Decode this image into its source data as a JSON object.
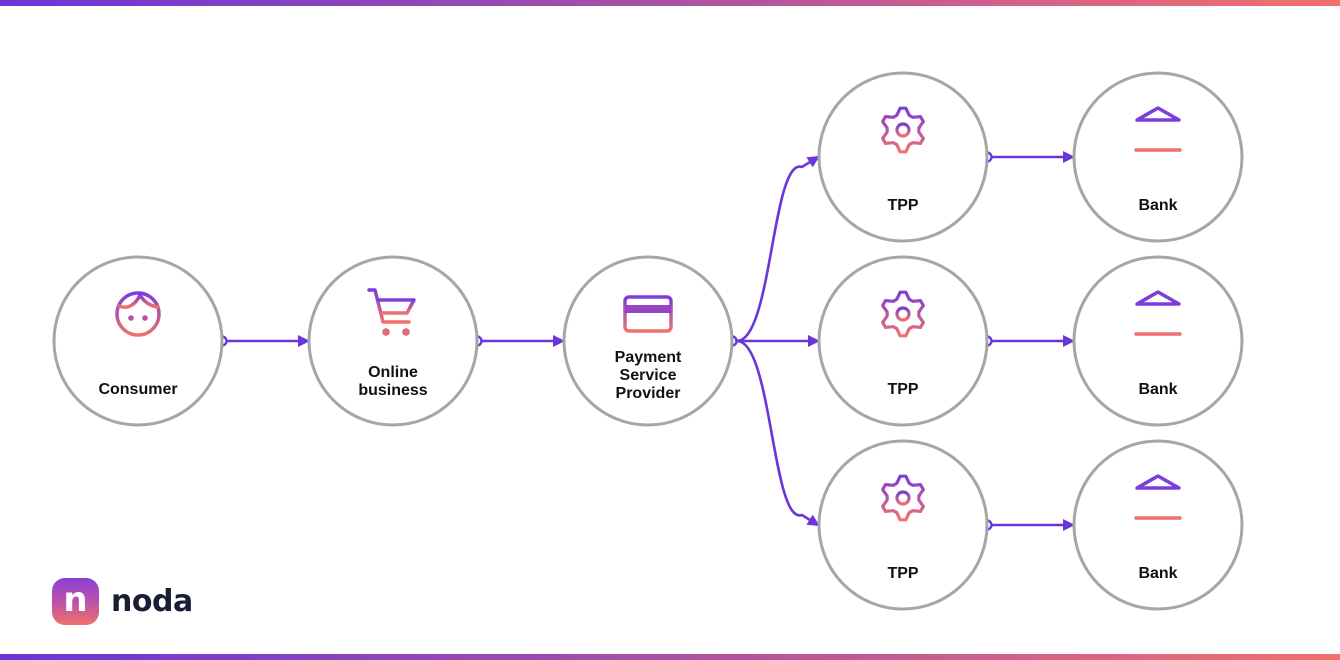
{
  "colors": {
    "accent": "#6a35d9",
    "gradient_start": "#6a35d9",
    "gradient_end": "#f0716c",
    "icon_gradient_top": "#7b3ddb",
    "icon_gradient_bottom": "#f0716c",
    "node_border": "#a6a6a6",
    "label": "#111111"
  },
  "nodes": [
    {
      "id": "consumer",
      "icon": "face-icon",
      "label_lines": [
        "Consumer"
      ]
    },
    {
      "id": "online-business",
      "icon": "shopping-cart-icon",
      "label_lines": [
        "Online",
        "business"
      ]
    },
    {
      "id": "psp",
      "icon": "credit-card-icon",
      "label_lines": [
        "Payment",
        "Service",
        "Provider"
      ]
    },
    {
      "id": "tpp-1",
      "icon": "gear-icon",
      "label_lines": [
        "TPP"
      ]
    },
    {
      "id": "tpp-2",
      "icon": "gear-icon",
      "label_lines": [
        "TPP"
      ]
    },
    {
      "id": "tpp-3",
      "icon": "gear-icon",
      "label_lines": [
        "TPP"
      ]
    },
    {
      "id": "bank-1",
      "icon": "bank-icon",
      "label_lines": [
        "Bank"
      ]
    },
    {
      "id": "bank-2",
      "icon": "bank-icon",
      "label_lines": [
        "Bank"
      ]
    },
    {
      "id": "bank-3",
      "icon": "bank-icon",
      "label_lines": [
        "Bank"
      ]
    }
  ],
  "edges": [
    {
      "from": "consumer",
      "to": "online-business"
    },
    {
      "from": "online-business",
      "to": "psp"
    },
    {
      "from": "psp",
      "to": "tpp-1"
    },
    {
      "from": "psp",
      "to": "tpp-2"
    },
    {
      "from": "psp",
      "to": "tpp-3"
    },
    {
      "from": "tpp-1",
      "to": "bank-1"
    },
    {
      "from": "tpp-2",
      "to": "bank-2"
    },
    {
      "from": "tpp-3",
      "to": "bank-3"
    }
  ],
  "brand": {
    "logo_letter": "n",
    "name": "noda"
  }
}
